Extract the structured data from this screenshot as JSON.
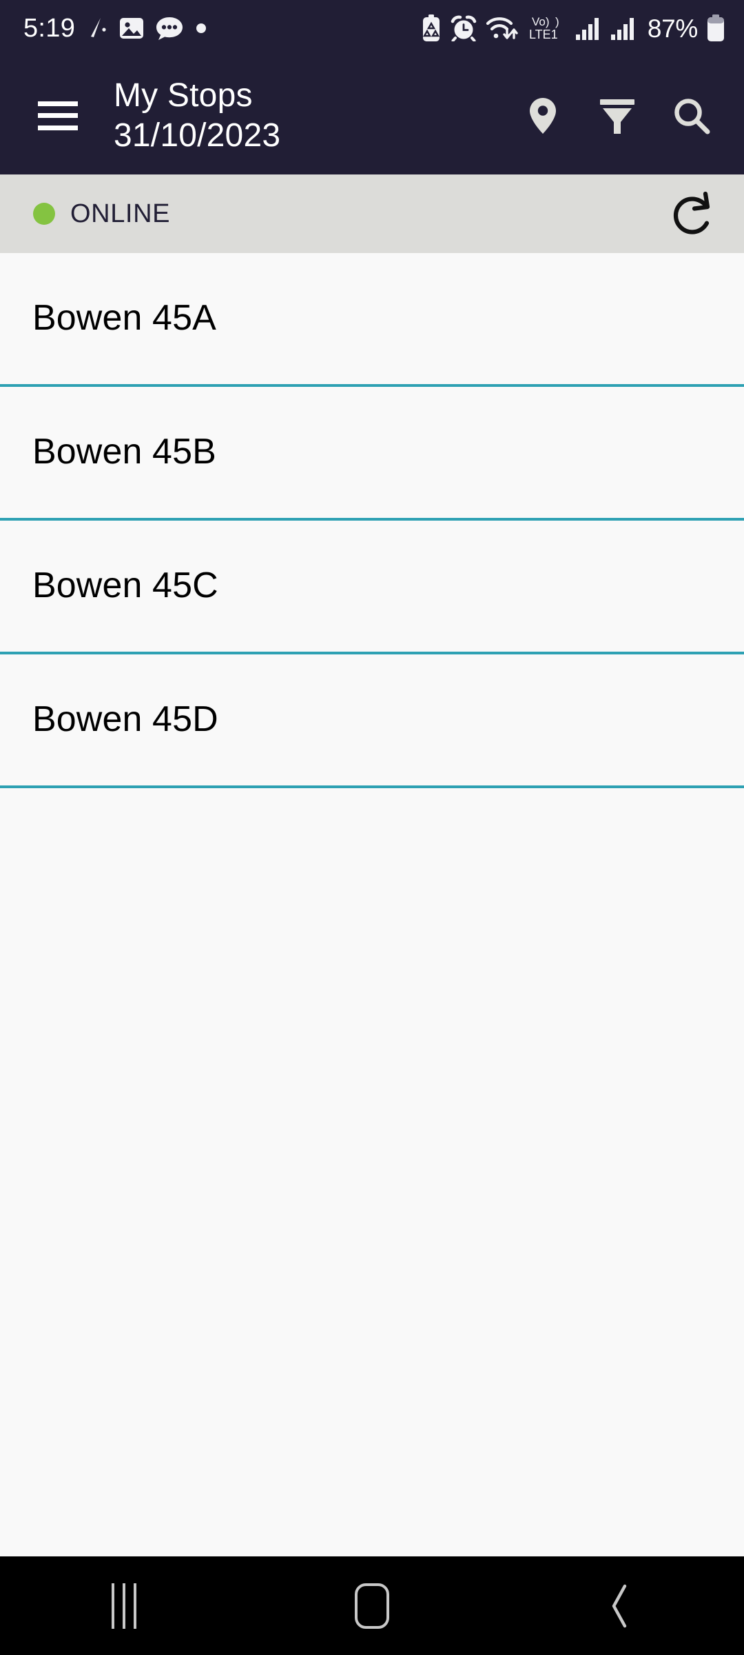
{
  "status_bar": {
    "time": "5:19",
    "battery_percent": "87%",
    "left_icons": [
      "pen-slash-icon",
      "gallery-image-icon",
      "chat-bubble-icon",
      "dot-indicator-icon"
    ],
    "right_icons": [
      "battery-saver-icon",
      "alarm-clock-icon",
      "wifi-icon",
      "volte-lte1-icon",
      "signal-bars-sim1-icon",
      "signal-bars-sim2-icon",
      "battery-icon"
    ],
    "network_label": "Vo))",
    "network_sub_label": "LTE1",
    "background_color": "#211E35"
  },
  "app_bar": {
    "menu_icon": "hamburger-menu-icon",
    "title": "My Stops",
    "subtitle": "31/10/2023",
    "actions": [
      {
        "name": "location-pin-icon",
        "label": "Location"
      },
      {
        "name": "filter-funnel-icon",
        "label": "Filter"
      },
      {
        "name": "search-icon",
        "label": "Search"
      }
    ],
    "background_color": "#211E35"
  },
  "status_strip": {
    "indicator_color": "#84C341",
    "label": "ONLINE",
    "refresh_icon": "refresh-icon",
    "background_color": "#DCDCD9"
  },
  "stops_list": {
    "divider_color": "#2EA1B3",
    "items": [
      {
        "label": "Bowen 45A"
      },
      {
        "label": "Bowen 45B"
      },
      {
        "label": "Bowen 45C"
      },
      {
        "label": "Bowen 45D"
      }
    ]
  },
  "nav_bar": {
    "recents_label": "Recents",
    "home_label": "Home",
    "back_label": "Back",
    "background_color": "#000000"
  }
}
